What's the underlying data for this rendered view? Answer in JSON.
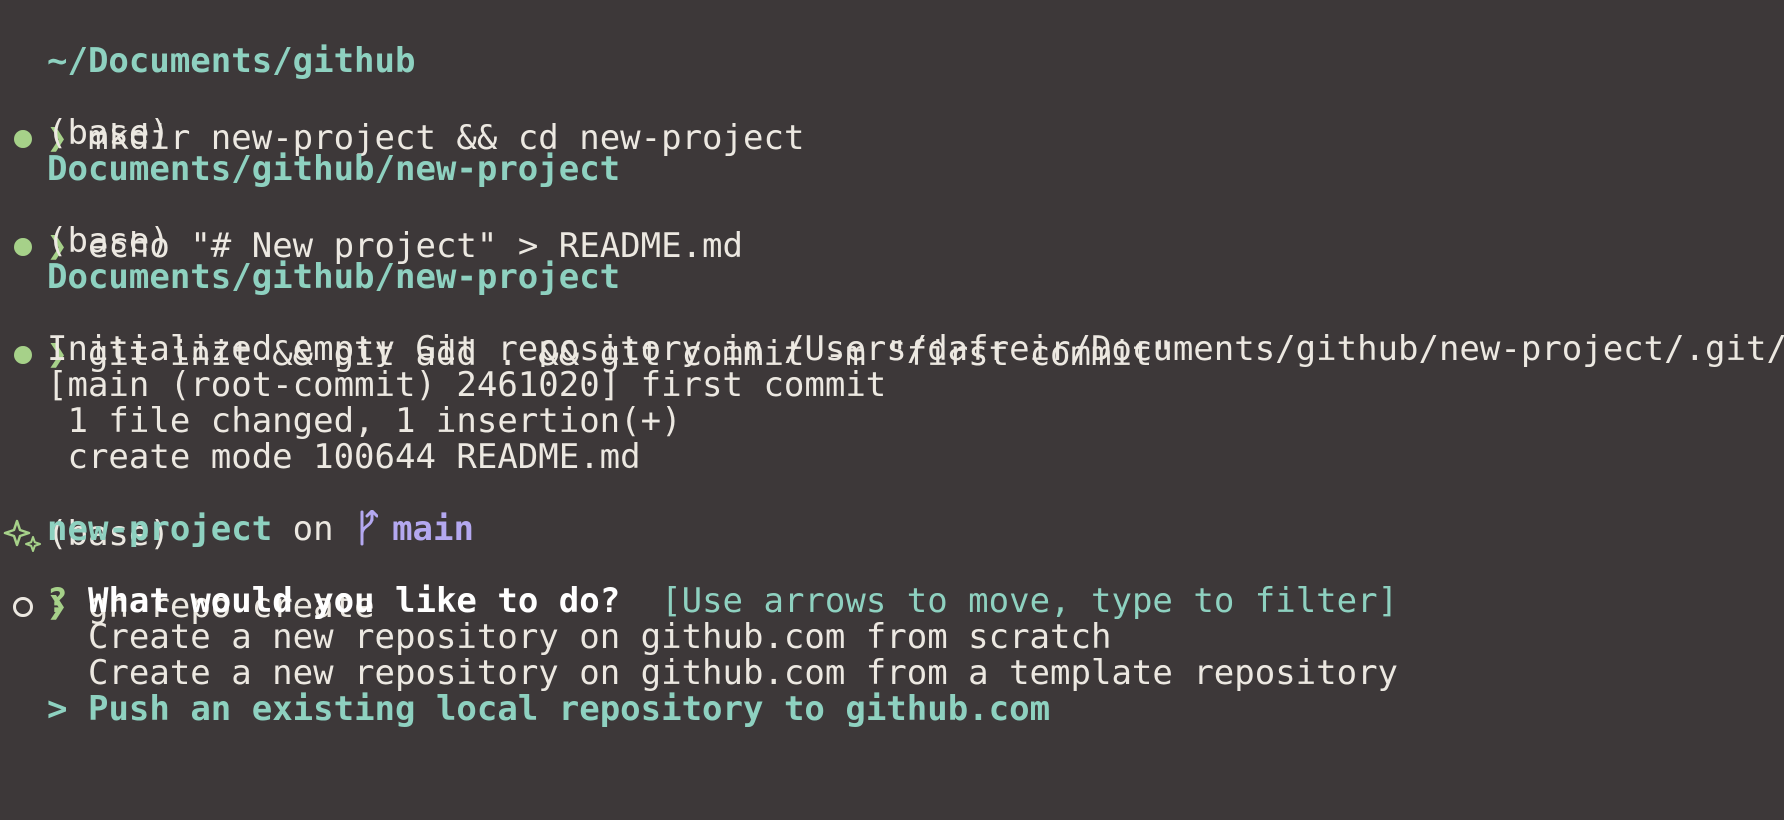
{
  "terminal": {
    "lines": [
      {
        "type": "path",
        "text": "~/Documents/github"
      },
      {
        "type": "command",
        "status": "success",
        "prompt": "❯",
        "text": "mkdir new-project && cd new-project"
      },
      {
        "type": "output",
        "text": "(base)"
      },
      {
        "type": "path",
        "text": "Documents/github/new-project"
      },
      {
        "type": "command",
        "status": "success",
        "prompt": "❯",
        "text": "echo \"# New project\" > README.md"
      },
      {
        "type": "output",
        "text": "(base)"
      },
      {
        "type": "path",
        "text": "Documents/github/new-project"
      },
      {
        "type": "command",
        "status": "success",
        "prompt": "❯",
        "text": "git init && git add . && git commit -m \"first commit\""
      },
      {
        "type": "output",
        "text": "Initialized empty Git repository in /Users/dafreir/Documents/github/new-project/.git/"
      },
      {
        "type": "output",
        "text": "[main (root-commit) 2461020] first commit"
      },
      {
        "type": "output",
        "text": " 1 file changed, 1 insertion(+)"
      },
      {
        "type": "output",
        "text": " create mode 100644 README.md"
      },
      {
        "type": "output-sparkle",
        "text": "(base)"
      },
      {
        "type": "repo-status",
        "dir": "new-project",
        "on": " on ",
        "branch_icon": "git-branch-icon",
        "branch": "main"
      },
      {
        "type": "command",
        "status": "pending",
        "prompt": "❯",
        "text": "gh repo create"
      },
      {
        "type": "question",
        "mark": "?",
        "question": "What would you like to do?",
        "hint": "[Use arrows to move, type to filter]"
      },
      {
        "type": "option",
        "text": "Create a new repository on github.com from scratch"
      },
      {
        "type": "option",
        "text": "Create a new repository on github.com from a template repository"
      },
      {
        "type": "option-selected",
        "cursor": ">",
        "text": "Push an existing local repository to github.com"
      }
    ]
  },
  "colors": {
    "background": "#3d3839",
    "foreground": "#ece8e1",
    "path": "#8ed1c0",
    "success": "#a6d189",
    "branch": "#b4a8f0"
  }
}
